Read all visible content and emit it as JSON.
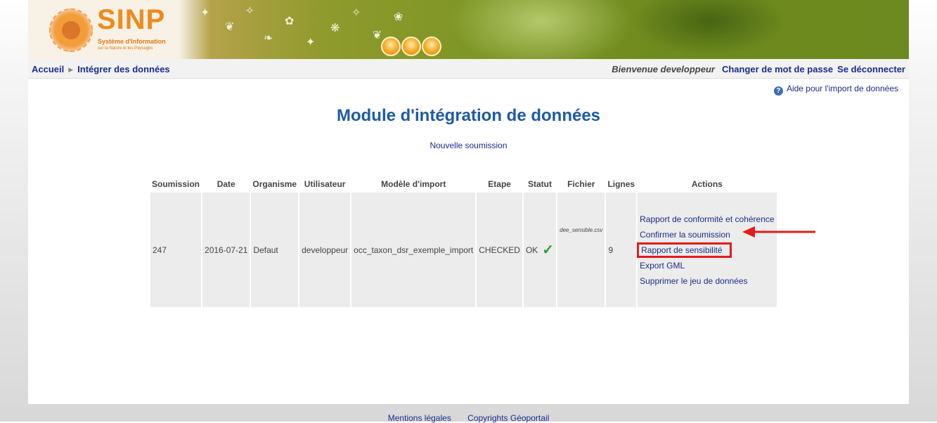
{
  "logo": {
    "name": "SINP",
    "subtitle_line1": "Système d'Information",
    "subtitle_line2": "sur la Nature et les Paysages"
  },
  "breadcrumb": {
    "home": "Accueil",
    "current": "Intégrer des données"
  },
  "user": {
    "welcome": "Bienvenue developpeur",
    "change_password": "Changer de mot de passe",
    "logout": "Se déconnecter"
  },
  "help_link": "Aide pour l'import de données",
  "title": "Module d'intégration de données",
  "new_submission": "Nouvelle soumission",
  "table": {
    "headers": [
      "Soumission",
      "Date",
      "Organisme",
      "Utilisateur",
      "Modèle d'import",
      "Etape",
      "Statut",
      "Fichier",
      "Lignes",
      "Actions"
    ],
    "row": {
      "submission": "247",
      "date": "2016-07-21",
      "organism": "Defaut",
      "user": "developpeur",
      "model": "occ_taxon_dsr_exemple_import",
      "step": "CHECKED",
      "status": "OK",
      "status_icon": "check-icon",
      "file": "dee_sensible.csv",
      "lines": "9",
      "actions": [
        "Rapport de conformité et cohérence",
        "Confirmer la soumission",
        "Rapport de sensibilité",
        "Export GML",
        "Supprimer le jeu de données"
      ]
    }
  },
  "highlight": {
    "action": "Rapport de sensibilité",
    "color": "#e21b1b"
  },
  "footer": {
    "legal": "Mentions légales",
    "copyright": "Copyrights Géoportail"
  },
  "colors": {
    "title": "#1d5aa8",
    "link": "#1a2c8c",
    "banner_green": "#7f9626",
    "logo_orange": "#f08a1e",
    "status_ok": "#2aa02a"
  }
}
